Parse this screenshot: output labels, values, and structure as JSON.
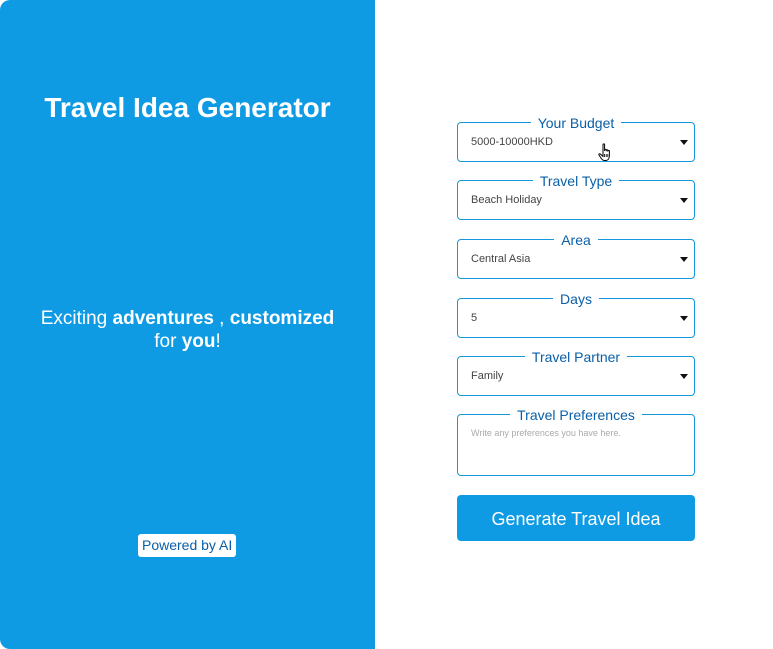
{
  "left_panel": {
    "title": "Travel Idea Generator",
    "tagline": {
      "part1": "Exciting ",
      "bold1": "adventures",
      "part2": " , ",
      "bold2": "customized",
      "part3": "for ",
      "bold3": "you",
      "part4": "!"
    },
    "powered_by": "Powered by AI",
    "background_color": "#0e9be4"
  },
  "form": {
    "budget": {
      "label": "Your Budget",
      "value": "5000-10000HKD"
    },
    "travel_type": {
      "label": "Travel Type",
      "value": "Beach Holiday"
    },
    "area": {
      "label": "Area",
      "value": "Central Asia"
    },
    "days": {
      "label": "Days",
      "value": "5"
    },
    "travel_partner": {
      "label": "Travel Partner",
      "value": "Family"
    },
    "preferences": {
      "label": "Travel Preferences",
      "placeholder": "Write any preferences you have here."
    },
    "submit_label": "Generate Travel Idea"
  },
  "colors": {
    "accent": "#0e9be4",
    "border": "#1797dc",
    "label": "#0a5fa8"
  },
  "icons": {
    "cursor": "hand-pointer-icon",
    "dropdown": "chevron-down-icon"
  }
}
